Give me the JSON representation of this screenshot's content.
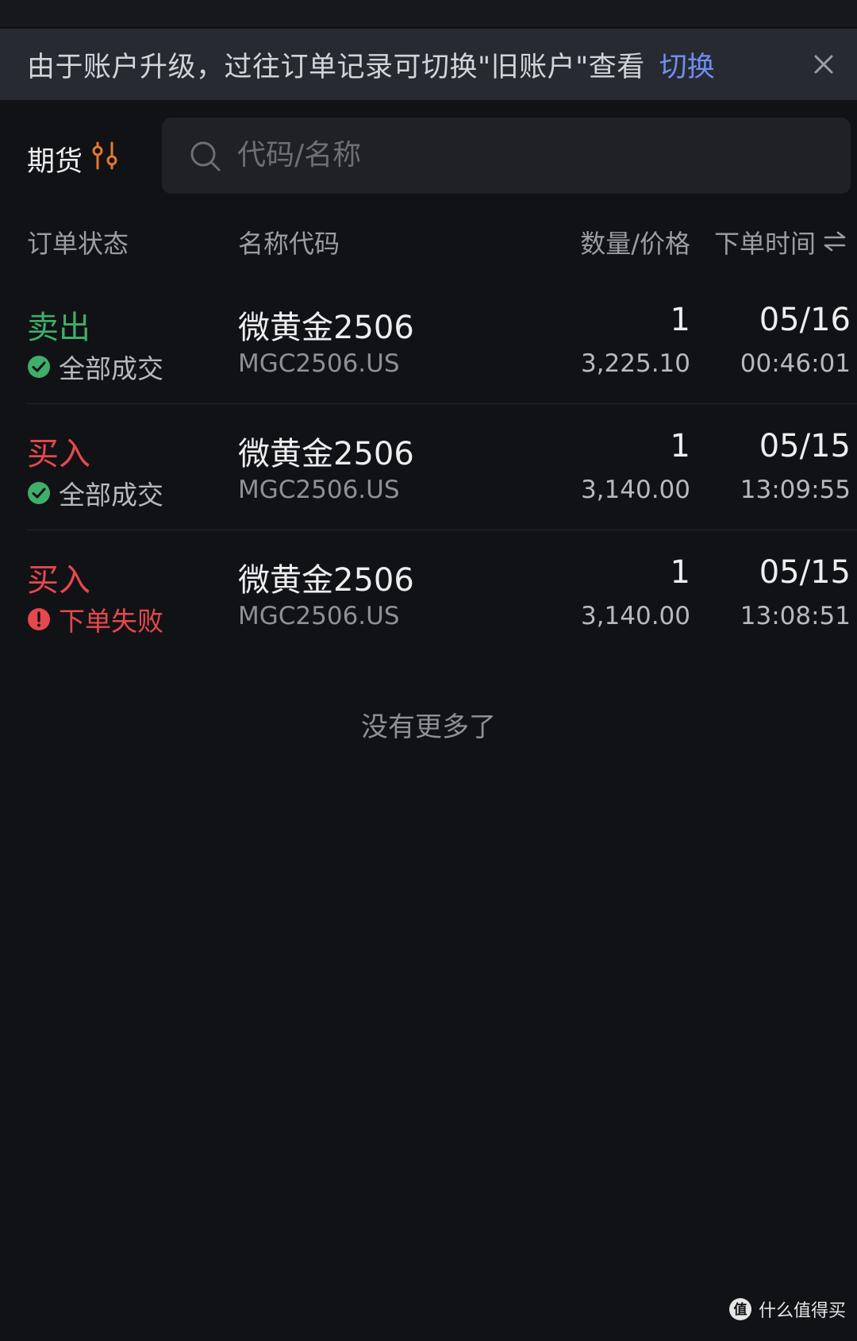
{
  "banner": {
    "text": "由于账户升级，过往订单记录可切换\"旧账户\"查看",
    "link_label": "切换"
  },
  "filter": {
    "market_label": "期货",
    "search_placeholder": "代码/名称"
  },
  "table_header": {
    "status": "订单状态",
    "name": "名称代码",
    "qty_price": "数量/价格",
    "time": "下单时间"
  },
  "orders": [
    {
      "side": "卖出",
      "side_type": "sell",
      "status": "全部成交",
      "status_type": "ok",
      "name": "微黄金2506",
      "code": "MGC2506.US",
      "qty": "1",
      "price": "3,225.10",
      "date": "05/16",
      "time": "00:46:01"
    },
    {
      "side": "买入",
      "side_type": "buy",
      "status": "全部成交",
      "status_type": "ok",
      "name": "微黄金2506",
      "code": "MGC2506.US",
      "qty": "1",
      "price": "3,140.00",
      "date": "05/15",
      "time": "13:09:55"
    },
    {
      "side": "买入",
      "side_type": "buy",
      "status": "下单失败",
      "status_type": "fail",
      "name": "微黄金2506",
      "code": "MGC2506.US",
      "qty": "1",
      "price": "3,140.00",
      "date": "05/15",
      "time": "13:08:51"
    }
  ],
  "footer": {
    "no_more": "没有更多了"
  },
  "watermark": {
    "text": "什么值得买"
  },
  "colors": {
    "sell": "#3fae6a",
    "buy": "#e5484d",
    "accent_orange": "#e8772e",
    "link_blue": "#6f8df0"
  }
}
